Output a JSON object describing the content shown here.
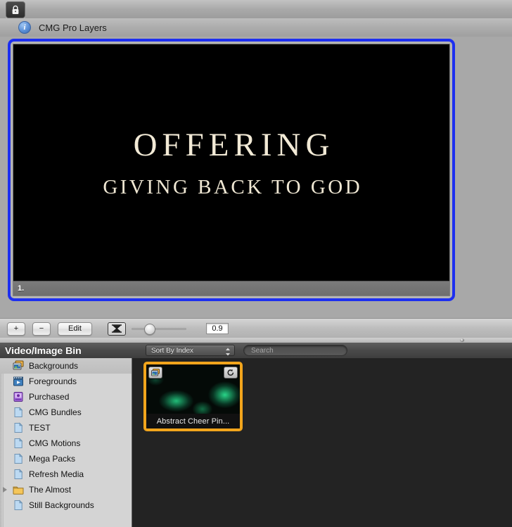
{
  "window": {
    "lock_icon": "lock-icon",
    "info_icon": "info-icon",
    "document_title": "CMG Pro Layers"
  },
  "slide": {
    "number_label": "1.",
    "title": "OFFERING",
    "subtitle": "GIVING BACK TO GOD",
    "title_color": "#f2ead6",
    "background_color": "#000000",
    "selection_color": "#1d2ff0"
  },
  "controls": {
    "add_label": "+",
    "remove_label": "−",
    "edit_label": "Edit",
    "slider_icon": "transition-duration-icon",
    "slider_value_percent": 28,
    "value_field": "0.9"
  },
  "bin": {
    "title": "Video/Image Bin",
    "sort": {
      "label": "Sort By Index",
      "arrows_icon": "updown-arrows-icon"
    },
    "search": {
      "placeholder": "Search"
    },
    "sidebar": {
      "items": [
        {
          "label": "Backgrounds",
          "icon": "images-stack-icon",
          "selected": true,
          "disclosure": false
        },
        {
          "label": "Foregrounds",
          "icon": "video-clip-icon",
          "selected": false,
          "disclosure": false
        },
        {
          "label": "Purchased",
          "icon": "purchased-icon",
          "selected": false,
          "disclosure": false
        },
        {
          "label": "CMG Bundles",
          "icon": "document-icon",
          "selected": false,
          "disclosure": false
        },
        {
          "label": "TEST",
          "icon": "document-icon",
          "selected": false,
          "disclosure": false
        },
        {
          "label": "CMG Motions",
          "icon": "document-icon",
          "selected": false,
          "disclosure": false
        },
        {
          "label": "Mega Packs",
          "icon": "document-icon",
          "selected": false,
          "disclosure": false
        },
        {
          "label": "Refresh Media",
          "icon": "document-icon",
          "selected": false,
          "disclosure": false
        },
        {
          "label": "The Almost",
          "icon": "folder-icon",
          "selected": false,
          "disclosure": true
        },
        {
          "label": "Still Backgrounds",
          "icon": "document-icon",
          "selected": false,
          "disclosure": false
        }
      ]
    },
    "items": [
      {
        "label": "Abstract Cheer Pin...",
        "badge_top_left": "images-stack-icon",
        "badge_top_right": "loop-icon",
        "selected": true,
        "selection_color": "#f2a51c"
      }
    ]
  }
}
